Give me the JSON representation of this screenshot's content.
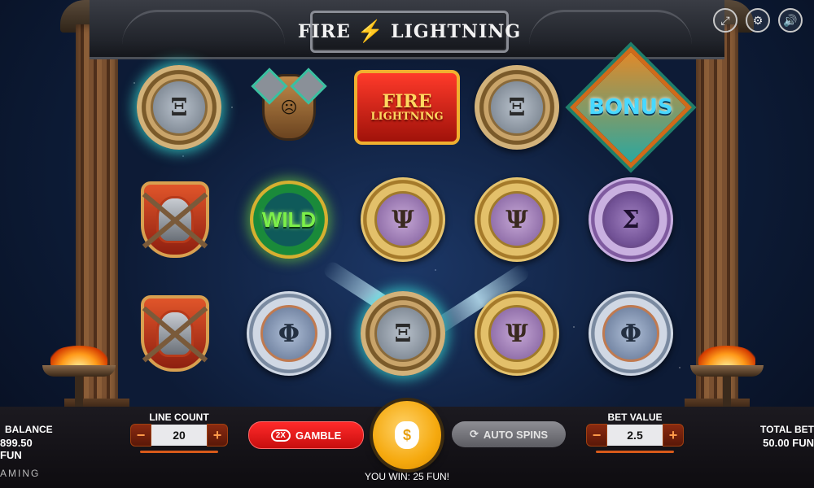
{
  "title": {
    "left": "FIRE",
    "right": "LIGHTNING"
  },
  "top_icons": [
    {
      "name": "fullscreen-icon",
      "glyph": "⤢"
    },
    {
      "name": "settings-icon",
      "glyph": "⚙"
    },
    {
      "name": "sound-icon",
      "glyph": "🔊"
    }
  ],
  "reels": {
    "rows": [
      [
        "xi-coin",
        "green-mask",
        "fire-lightning-emblem",
        "xi-coin",
        "bonus"
      ],
      [
        "warrior-shield",
        "wild",
        "psi-coin",
        "psi-coin",
        "sigma-coin"
      ],
      [
        "warrior-shield",
        "phi-coin",
        "xi-coin",
        "psi-coin",
        "phi-coin"
      ]
    ],
    "coin_glyphs": {
      "xi": "Ξ",
      "psi": "Ψ",
      "sigma": "Σ",
      "phi": "Φ"
    },
    "emblem_text": {
      "line1": "FIRE",
      "line2": "LIGHTNING"
    },
    "wild_text": "WILD",
    "bonus_text": "BONUS"
  },
  "bottom_bar": {
    "balance_label": "BALANCE",
    "balance_value": "899.50 FUN",
    "line_count_label": "LINE COUNT",
    "line_count_value": "20",
    "gamble_badge": "2X",
    "gamble_label": "GAMBLE",
    "auto_spins_label": "AUTO SPINS",
    "bet_value_label": "BET VALUE",
    "bet_value": "2.5",
    "total_bet_label": "TOTAL BET",
    "total_bet_value": "50.00 FUN",
    "win_text": "YOU WIN: 25 FUN!",
    "brand_text": "AMING",
    "spin_icon": "$"
  },
  "colors": {
    "gamble": "#ff2a2a",
    "spin": "#f5a90e",
    "auto_spins": "#7a7a80",
    "stepper_accent": "#d85a1a"
  }
}
